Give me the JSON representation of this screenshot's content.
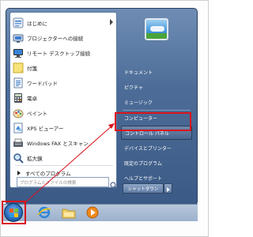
{
  "start_menu": {
    "programs": [
      {
        "label": "はじめに",
        "icon": "getting-started-icon",
        "has_submenu": true
      },
      {
        "label": "プロジェクターへの接続",
        "icon": "projector-icon",
        "has_submenu": false
      },
      {
        "label": "リモート デスクトップ接続",
        "icon": "remote-desktop-icon",
        "has_submenu": false
      },
      {
        "label": "付箋",
        "icon": "sticky-notes-icon",
        "has_submenu": false
      },
      {
        "label": "ワードパッド",
        "icon": "wordpad-icon",
        "has_submenu": false
      },
      {
        "label": "電卓",
        "icon": "calculator-icon",
        "has_submenu": false
      },
      {
        "label": "ペイント",
        "icon": "paint-icon",
        "has_submenu": false
      },
      {
        "label": "XPS ビューアー",
        "icon": "xps-viewer-icon",
        "has_submenu": false
      },
      {
        "label": "Windows FAX とスキャン",
        "icon": "fax-scan-icon",
        "has_submenu": false
      },
      {
        "label": "拡大鏡",
        "icon": "magnifier-icon",
        "has_submenu": false
      }
    ],
    "all_programs_label": "すべてのプログラム",
    "search_placeholder": "プログラムとファイルの検索",
    "right_items": [
      {
        "label": "ドキュメント"
      },
      {
        "label": "ピクチャ"
      },
      {
        "label": "ミュージック"
      },
      {
        "label": "コンピューター"
      },
      {
        "label": "コントロール パネル",
        "highlighted": true
      },
      {
        "label": "デバイスとプリンター"
      },
      {
        "label": "既定のプログラム"
      },
      {
        "label": "ヘルプとサポート"
      }
    ],
    "shutdown_label": "シャットダウン"
  },
  "taskbar": {
    "items": [
      {
        "icon": "start-orb-icon"
      },
      {
        "icon": "internet-explorer-icon"
      },
      {
        "icon": "explorer-folder-icon"
      },
      {
        "icon": "media-player-icon"
      }
    ]
  },
  "colors": {
    "annotation": "#d9141c",
    "accent": "#3b5a86"
  }
}
